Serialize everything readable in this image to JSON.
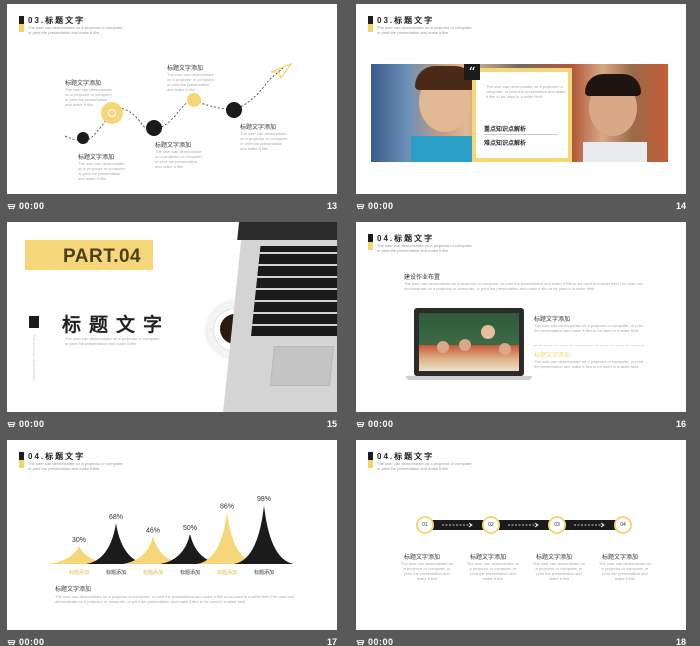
{
  "footer_time": "00:00",
  "slides": [
    {
      "number": "13",
      "header": {
        "title": "03.标题文字",
        "subtitle_1": "The user can demonstrate on a projector or computer,",
        "subtitle_2": "or print the presentation and make it film"
      },
      "steps": [
        {
          "label": "标题文字添加",
          "desc": "The user can demonstrate on a projector or computer, or print the presentation and make it film"
        },
        {
          "label": "标题文字添加",
          "desc": "The user can demonstrate on a projector or computer, or print the presentation and make it film"
        },
        {
          "label": "标题文字添加",
          "desc": "The user can demonstrate on a projector or computer, or print the presentation and make it film"
        },
        {
          "label": "标题文字添加",
          "desc": "The user can demonstrate on a projector or computer, or print the presentation and make it film"
        },
        {
          "label": "标题文字添加",
          "desc": "The user can demonstrate on a projector or computer, or print the presentation and make it film"
        }
      ]
    },
    {
      "number": "14",
      "header": {
        "title": "03.标题文字",
        "subtitle_1": "The user can demonstrate on a projector or computer,",
        "subtitle_2": "or print the presentation and make it film"
      },
      "quote_icon": "quote-icon",
      "box_desc": "The user can demonstrate on a projector or computer, or print the presentation and make it film to be used in a wider field",
      "line1": "重点知识点解析",
      "line2": "难点知识点解析"
    },
    {
      "number": "15",
      "part": "PART.04",
      "title": "标题文字",
      "vertical": "The user can demonstrate",
      "desc_1": "The user can demonstrate on a projector or computer,",
      "desc_2": "or print the presentation and make it film"
    },
    {
      "number": "16",
      "header": {
        "title": "04.标题文字",
        "subtitle_1": "The user can demonstrate on a projector or computer,",
        "subtitle_2": "or print the presentation and make it film"
      },
      "heading": "建设作业布置",
      "heading_desc_1": "The user can demonstrate on a projector or computer, or print the presentation and make it film to be used in a wider field The user can",
      "heading_desc_2": "demonstrate on a projector or computer, or print the presentation and make it film to be used in a wider field",
      "items": [
        {
          "label": "标题文字添加",
          "desc_1": "The user can demonstrate on a projector or computer, or print",
          "desc_2": "the presentation and make it film to be used in a wider field"
        },
        {
          "label": "标题文字添加",
          "desc_1": "The user can demonstrate on a projector or computer, or print",
          "desc_2": "the presentation and make it film to be used in a wider field"
        }
      ]
    },
    {
      "number": "17",
      "header": {
        "title": "04.标题文字",
        "subtitle_1": "The user can demonstrate on a projector or computer,",
        "subtitle_2": "or print the presentation and make it film"
      },
      "footer_title": "标题文字添加",
      "footer_desc_1": "The user can demonstrate on a projector or computer, or print the presentation and make it film to be used in a wider field The user can",
      "footer_desc_2": "demonstrate on a projector or computer, or print the presentation and make it film to be used in a wider field",
      "chart_data": {
        "type": "area",
        "categories": [
          "标题添加",
          "标题添加",
          "标题添加",
          "标题添加",
          "标题添加",
          "标题添加"
        ],
        "values": [
          30,
          68,
          46,
          50,
          86,
          98
        ],
        "unit": "%",
        "colors": [
          "#f5d77a",
          "#1b1b1b",
          "#f5d77a",
          "#1b1b1b",
          "#f5d77a",
          "#1b1b1b"
        ]
      }
    },
    {
      "number": "18",
      "header": {
        "title": "04.标题文字",
        "subtitle_1": "The user can demonstrate on a projector or computer,",
        "subtitle_2": "or print the presentation and make it film"
      },
      "nodes": [
        {
          "num": "01",
          "label": "标题文字添加",
          "desc": "The user can demonstrate on a projector or computer, or print the presentation and make it film"
        },
        {
          "num": "02",
          "label": "标题文字添加",
          "desc": "The user can demonstrate on a projector or computer, or print the presentation and make it film"
        },
        {
          "num": "03",
          "label": "标题文字添加",
          "desc": "The user can demonstrate on a projector or computer, or print the presentation and make it film"
        },
        {
          "num": "04",
          "label": "标题文字添加",
          "desc": "The user can demonstrate on a projector or computer, or print the presentation and make it film"
        }
      ]
    }
  ],
  "colors": {
    "accent": "#f5d77a",
    "dark": "#1b1b1b",
    "background": "#595959"
  }
}
